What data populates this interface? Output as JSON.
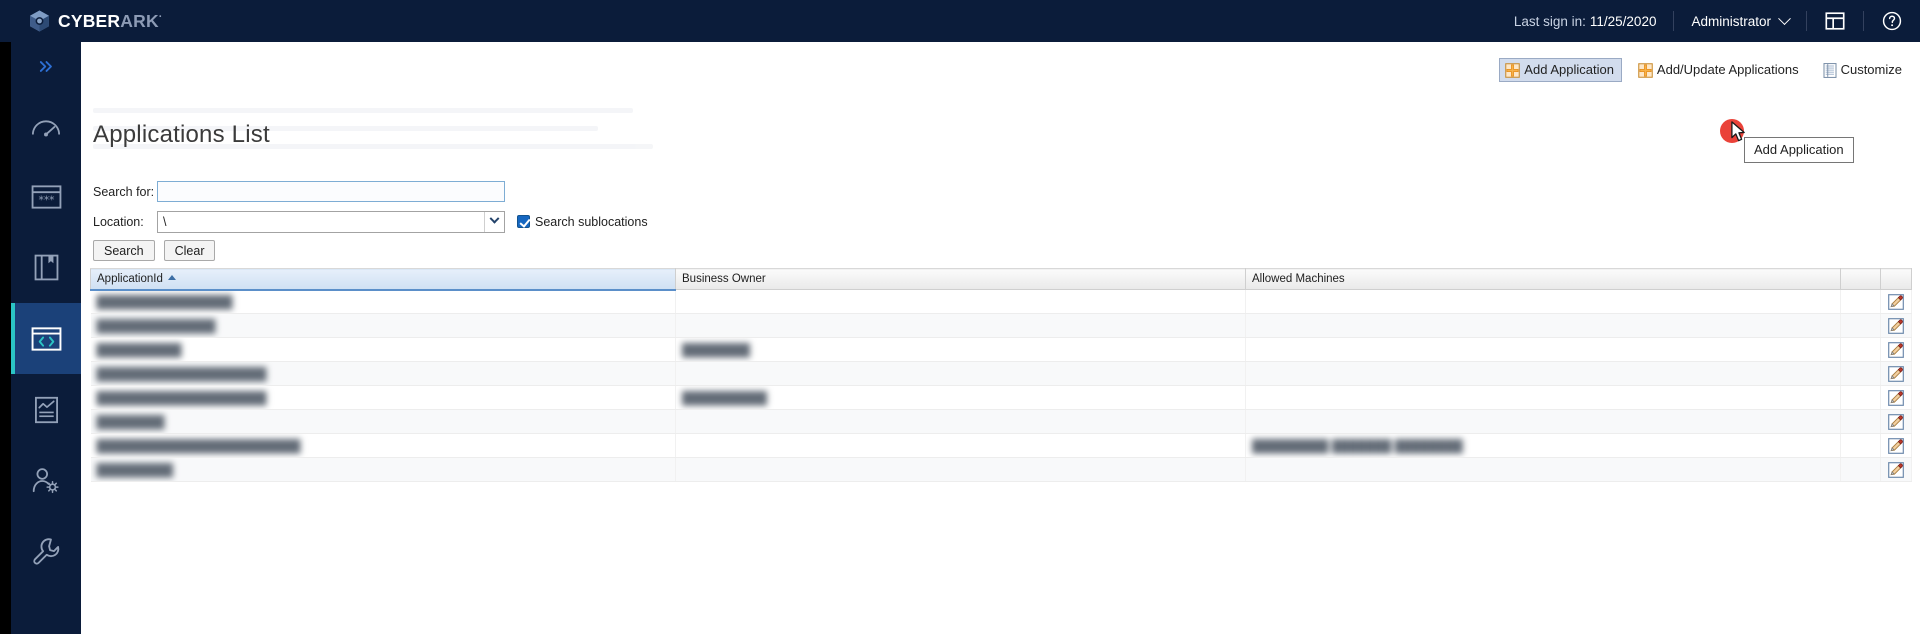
{
  "brand": {
    "part1": "CYBER",
    "part2": "ARK",
    "trademark": "·",
    "logo_icon": "cyberark-cube-icon"
  },
  "header": {
    "last_signin_label": "Last sign in:",
    "last_signin_date": "11/25/2020",
    "user_name": "Administrator",
    "user_caret_icon": "chevron-down-icon",
    "layout_icon": "layout-panels-icon",
    "help_icon": "question-circle-icon"
  },
  "sidebar": {
    "expand_icon": "chevron-double-right-icon",
    "items": [
      {
        "name": "dashboard",
        "icon": "gauge-icon",
        "active": false
      },
      {
        "name": "accounts",
        "icon": "password-vault-icon",
        "active": false
      },
      {
        "name": "policies",
        "icon": "book-icon",
        "active": false
      },
      {
        "name": "applications",
        "icon": "code-brackets-icon",
        "active": true
      },
      {
        "name": "reports",
        "icon": "report-chart-icon",
        "active": false
      },
      {
        "name": "administration",
        "icon": "user-gear-icon",
        "active": false
      },
      {
        "name": "tools",
        "icon": "wrench-icon",
        "active": false
      }
    ]
  },
  "toolbar": {
    "add_application": {
      "label": "Add Application",
      "icon": "plus-square-icon",
      "pressed": true
    },
    "add_update_applications": {
      "label": "Add/Update Applications",
      "icon": "plus-square-icon",
      "pressed": false
    },
    "customize": {
      "label": "Customize",
      "icon": "list-columns-icon",
      "pressed": false
    }
  },
  "tooltip": {
    "text": "Add Application"
  },
  "cursor": {
    "icon": "mouse-pointer-icon",
    "click_marker": "red-click-halo"
  },
  "page": {
    "title": "Applications List"
  },
  "search_form": {
    "search_for_label": "Search for:",
    "search_for_value": "",
    "search_for_placeholder": "",
    "location_label": "Location:",
    "location_value": "\\",
    "location_caret_icon": "chevron-down-icon",
    "search_sublocations_label": "Search sublocations",
    "search_sublocations_checked": true,
    "search_button": "Search",
    "clear_button": "Clear"
  },
  "table": {
    "columns": [
      {
        "key": "application_id",
        "label": "ApplicationId",
        "sorted": true,
        "sort_dir": "asc",
        "sort_icon": "sort-ascending-icon"
      },
      {
        "key": "business_owner",
        "label": "Business Owner",
        "sorted": false
      },
      {
        "key": "allowed_machines",
        "label": "Allowed Machines",
        "sorted": false
      },
      {
        "key": "spacer",
        "label": "",
        "sorted": false
      },
      {
        "key": "edit",
        "label": "",
        "sorted": false
      }
    ],
    "row_edit_icon": "edit-pencil-icon",
    "rows": [
      {
        "application_id": "████████████████",
        "business_owner": "",
        "allowed_machines": ""
      },
      {
        "application_id": "██████████████",
        "business_owner": "",
        "allowed_machines": ""
      },
      {
        "application_id": "██████████",
        "business_owner": "████████",
        "allowed_machines": ""
      },
      {
        "application_id": "████████████████████",
        "business_owner": "",
        "allowed_machines": ""
      },
      {
        "application_id": "████████████████████",
        "business_owner": "██████████",
        "allowed_machines": ""
      },
      {
        "application_id": "████████",
        "business_owner": "",
        "allowed_machines": ""
      },
      {
        "application_id": "████████████████████████",
        "business_owner": "",
        "allowed_machines": "█████████  ███████  ████████"
      },
      {
        "application_id": "█████████",
        "business_owner": "",
        "allowed_machines": ""
      }
    ]
  }
}
